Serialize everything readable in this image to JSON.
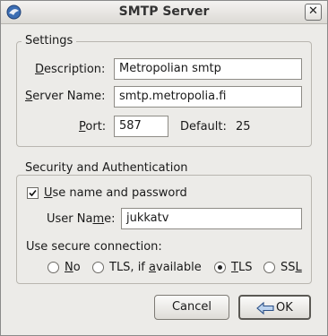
{
  "window": {
    "title": "SMTP Server"
  },
  "settings": {
    "legend": "Settings",
    "description_label_pre": "",
    "description_label_u": "D",
    "description_label_post": "escription:",
    "description_value": "Metropolian smtp",
    "server_label_u": "S",
    "server_label_post": "erver Name:",
    "server_value": "smtp.metropolia.fi",
    "port_label_u": "P",
    "port_label_post": "ort:",
    "port_value": "587",
    "default_label": "Default:",
    "default_value": "25"
  },
  "security": {
    "legend": "Security and Authentication",
    "use_name_pre": "",
    "use_name_u": "U",
    "use_name_post": "se name and password",
    "use_name_checked": true,
    "username_pre": "User Na",
    "username_u": "m",
    "username_post": "e:",
    "username_value": "jukkatv",
    "secure_label": "Use secure connection:",
    "options": [
      {
        "pre": "",
        "u": "N",
        "post": "o",
        "selected": false
      },
      {
        "pre": "TLS, if ",
        "u": "a",
        "post": "vailable",
        "selected": false
      },
      {
        "pre": "",
        "u": "T",
        "post": "LS",
        "selected": true
      },
      {
        "pre": "SS",
        "u": "L",
        "post": "",
        "selected": false
      }
    ]
  },
  "buttons": {
    "cancel": "Cancel",
    "ok": "OK"
  }
}
